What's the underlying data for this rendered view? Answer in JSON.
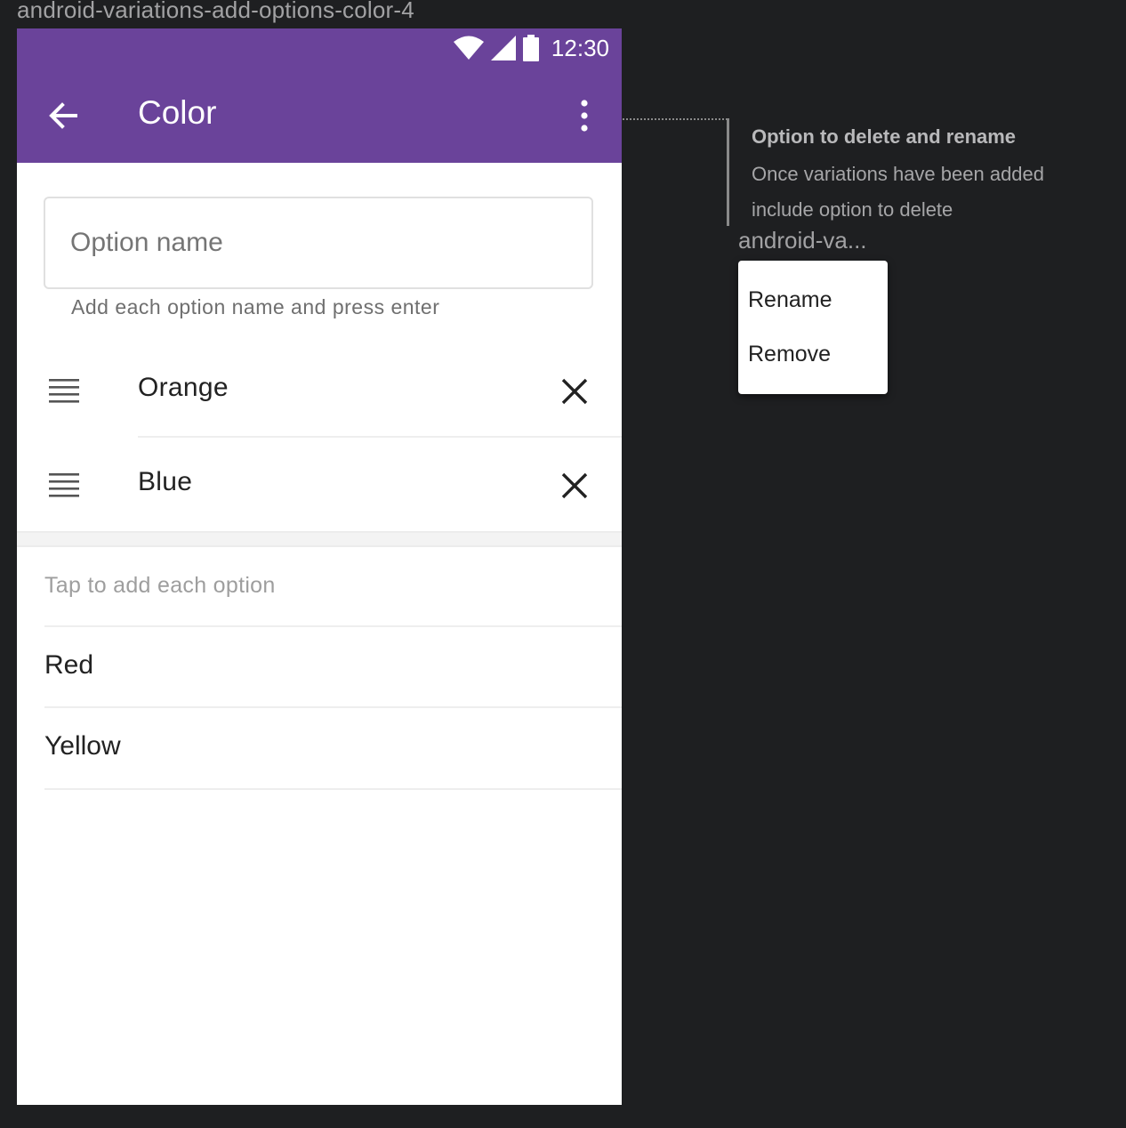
{
  "frame_label": "android-variations-add-options-color-4",
  "status_bar": {
    "time": "12:30"
  },
  "appbar": {
    "title": "Color",
    "color": "#6a439a"
  },
  "option_input": {
    "placeholder": "Option name",
    "value": "",
    "helper": "Add each option name and press enter"
  },
  "options": [
    {
      "label": "Orange"
    },
    {
      "label": "Blue"
    }
  ],
  "suggestions": {
    "header": "Tap to add each option",
    "items": [
      {
        "label": "Red"
      },
      {
        "label": "Yellow"
      }
    ]
  },
  "annotation": {
    "title": "Option to delete and rename",
    "body": "Once variations have been added include option to delete"
  },
  "menu_frame_label": "android-va...",
  "popup_menu": {
    "items": [
      {
        "label": "Rename"
      },
      {
        "label": "Remove"
      }
    ]
  },
  "icons": {
    "back": "arrow-back-icon",
    "overflow": "more-vert-icon",
    "drag": "drag-handle-icon",
    "close": "close-icon",
    "wifi": "wifi-icon",
    "signal": "signal-icon",
    "battery": "battery-icon"
  }
}
